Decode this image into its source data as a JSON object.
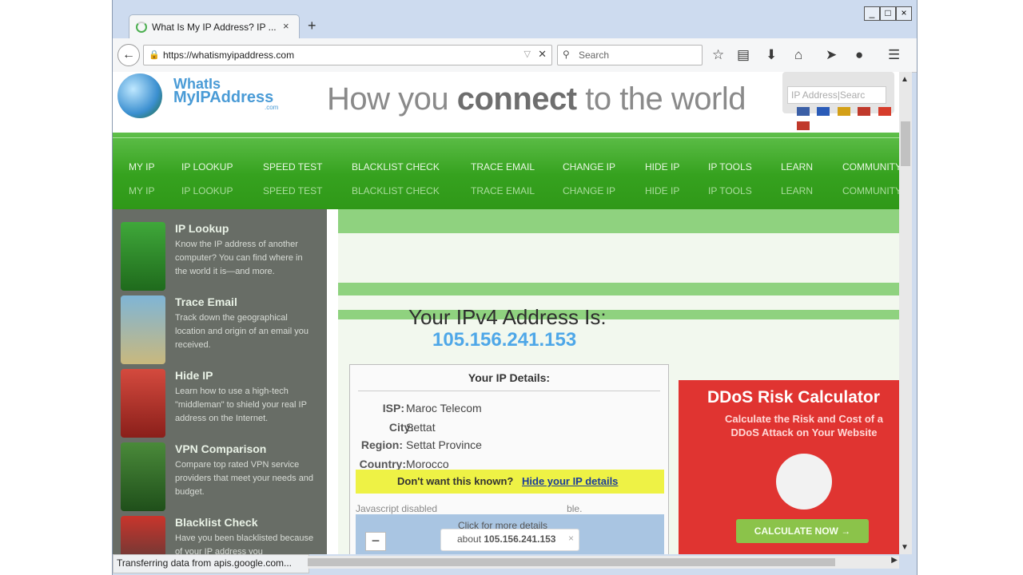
{
  "browser": {
    "tab_title": "What Is My IP Address? IP ...",
    "tab_close": "×",
    "new_tab": "+",
    "url_lock": "🔒",
    "url": "https://whatismyipaddress.com",
    "search_placeholder": "Search",
    "status_text": "Transferring data from apis.google.com...",
    "window_controls": [
      "_",
      "□",
      "×"
    ],
    "toolbar_icons": [
      "star-icon",
      "reading-list-icon",
      "download-icon",
      "home-icon",
      "send-icon",
      "chat-icon",
      "menu-icon"
    ]
  },
  "site": {
    "logo_line1": "WhatIs",
    "logo_line2": "MyIPAddress",
    "logo_com": ".com",
    "tagline_pre": "How you ",
    "tagline_bold": "connect",
    "tagline_post": " to the world",
    "search_placeholder": "IP Address|Searc",
    "flag_colors": [
      "#3b5fa6",
      "#2a5bb8",
      "#d4a017",
      "#c0392b",
      "#d63c2b",
      "#c0392b"
    ]
  },
  "menu": [
    "MY IP",
    "IP LOOKUP",
    "SPEED TEST",
    "BLACKLIST CHECK",
    "TRACE EMAIL",
    "CHANGE IP",
    "HIDE IP",
    "IP TOOLS",
    "LEARN",
    "COMMUNITY"
  ],
  "sidebar": [
    {
      "title": "IP Lookup",
      "desc": "Know the IP address of another computer? You can find where in the world it is—and more."
    },
    {
      "title": "Trace Email",
      "desc": "Track down the geographical location and origin of an email you received."
    },
    {
      "title": "Hide IP",
      "desc": "Learn how to use a high-tech \"middleman\" to shield your real IP address on the Internet."
    },
    {
      "title": "VPN Comparison",
      "desc": "Compare top rated VPN service providers that meet your needs and budget."
    },
    {
      "title": "Blacklist Check",
      "desc": "Have you been blacklisted because of your IP address you"
    }
  ],
  "main": {
    "ipv4_label": "Your IPv4 Address Is:",
    "ip": "105.156.241.153",
    "details_title": "Your IP Details:",
    "details": [
      {
        "key": "ISP:",
        "value": "Maroc Telecom"
      },
      {
        "key": "City:",
        "value": "Settat"
      },
      {
        "key": "Region:",
        "value": "Settat Province"
      },
      {
        "key": "Country:",
        "value": "Morocco"
      }
    ],
    "hide_question": "Don't want this known?",
    "hide_link": "Hide your IP details",
    "js_disabled": "Javascript disabled",
    "js_disabled_suffix": "ble.",
    "map_zoom_in": "+",
    "map_zoom_out": "−",
    "map_tip": "Click for more details",
    "map_tip2_pre": "about ",
    "map_tip2_ip": "105.156.241.153",
    "map_tip_close": "×"
  },
  "ddos": {
    "title": "DDoS Risk Calculator",
    "subtitle": "Calculate the Risk and Cost of a DDoS Attack on Your Website",
    "button": "CALCULATE NOW  →"
  }
}
